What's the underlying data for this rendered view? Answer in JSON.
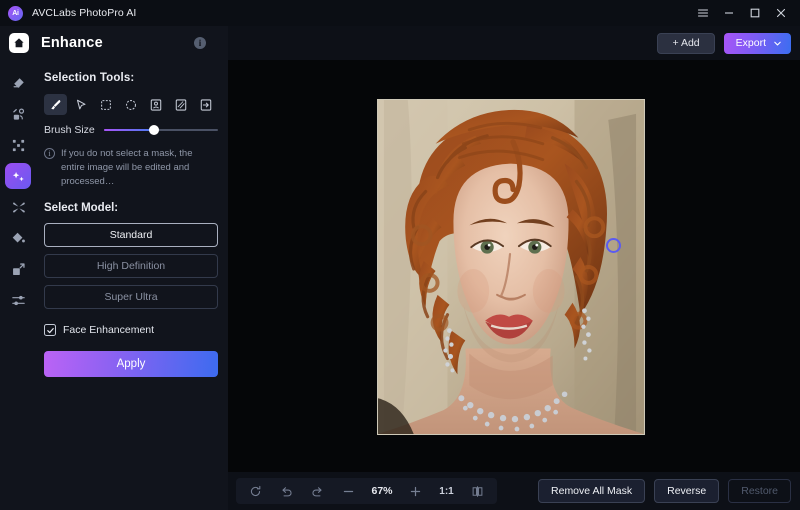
{
  "titlebar": {
    "app_name": "AVCLabs PhotoPro AI",
    "logo_text": "Ai",
    "controls": [
      {
        "name": "menu-icon",
        "label": "☰"
      },
      {
        "name": "minimize-icon",
        "label": "–"
      },
      {
        "name": "maximize-icon",
        "label": "□"
      },
      {
        "name": "close-icon",
        "label": "✕"
      }
    ]
  },
  "header": {
    "home_icon": "home-icon",
    "page_title": "Enhance",
    "info_icon": "i",
    "add_label": "+ Add",
    "export_label": "Export"
  },
  "rail": {
    "items": [
      {
        "name": "sidebar-item-eraser",
        "icon": "eraser-icon",
        "active": false
      },
      {
        "name": "sidebar-item-object-removal",
        "icon": "object-removal-icon",
        "active": false
      },
      {
        "name": "sidebar-item-upscale",
        "icon": "upscale-icon",
        "active": false
      },
      {
        "name": "sidebar-item-enhance",
        "icon": "magic-wand-icon",
        "active": true
      },
      {
        "name": "sidebar-item-retouch",
        "icon": "retouch-icon",
        "active": false
      },
      {
        "name": "sidebar-item-colorize",
        "icon": "color-drop-icon",
        "active": false
      },
      {
        "name": "sidebar-item-resize",
        "icon": "resize-icon",
        "active": false
      },
      {
        "name": "sidebar-item-adjust",
        "icon": "sliders-icon",
        "active": false
      }
    ]
  },
  "panel": {
    "selection_tools_label": "Selection Tools:",
    "tools": [
      {
        "name": "tool-brush",
        "icon": "brush-icon",
        "active": true
      },
      {
        "name": "tool-cursor",
        "icon": "cursor-arrow-icon",
        "active": false
      },
      {
        "name": "tool-rect-select",
        "icon": "rectangle-dashed-icon",
        "active": false
      },
      {
        "name": "tool-ellipse-select",
        "icon": "circle-dashed-icon",
        "active": false
      },
      {
        "name": "tool-portrait-select",
        "icon": "portrait-select-icon",
        "active": false
      },
      {
        "name": "tool-hatch-select",
        "icon": "hatch-select-icon",
        "active": false
      },
      {
        "name": "tool-import-mask",
        "icon": "arrow-into-box-icon",
        "active": false
      }
    ],
    "brush_size_label": "Brush Size",
    "brush_size_value": 44,
    "hint_icon": "i",
    "hint_text": "If you do not select a mask, the entire image will be edited and processed…",
    "select_model_label": "Select Model:",
    "models": [
      {
        "name": "model-standard",
        "label": "Standard",
        "selected": true
      },
      {
        "name": "model-high-definition",
        "label": "High Definition",
        "selected": false
      },
      {
        "name": "model-super-ultra",
        "label": "Super Ultra",
        "selected": false
      }
    ],
    "face_enhancement_label": "Face Enhancement",
    "face_enhancement_checked": true,
    "apply_label": "Apply"
  },
  "canvas": {
    "brush_cursor": "brush-cursor-circle",
    "image_alt": "portrait-photo"
  },
  "bottombar": {
    "reset_icon": "reset-icon",
    "undo_icon": "undo-icon",
    "redo_icon": "redo-icon",
    "zoom_out_icon": "minus-icon",
    "zoom_level": "67%",
    "zoom_in_icon": "plus-icon",
    "actual_size_label": "1:1",
    "compare_icon": "split-compare-icon",
    "remove_all_mask_label": "Remove All Mask",
    "reverse_label": "Reverse",
    "restore_label": "Restore",
    "restore_disabled": true
  },
  "colors": {
    "accent_purple": "#a855f7",
    "accent_blue": "#3b6ef0",
    "panel_bg": "#11141c",
    "canvas_bg": "#050608",
    "brush_cursor": "#5b5bf0"
  }
}
